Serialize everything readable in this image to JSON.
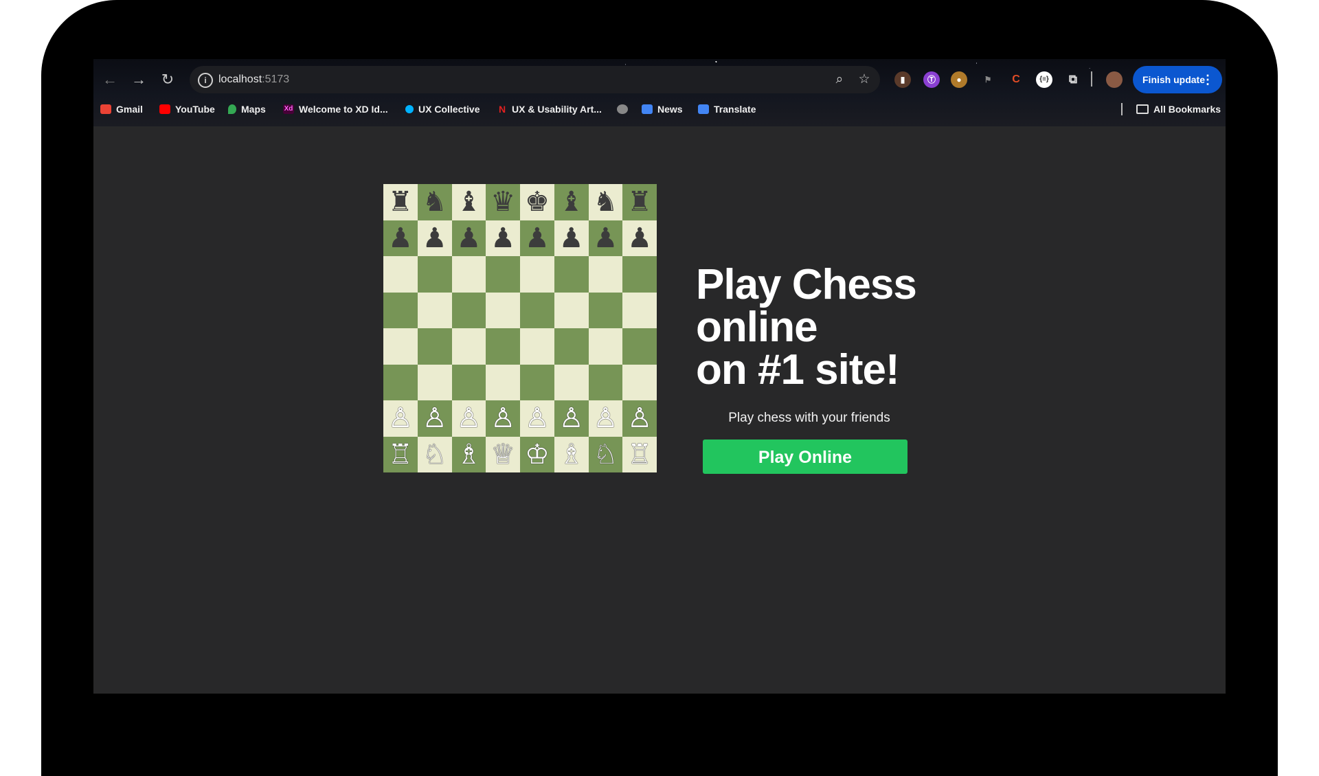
{
  "browser": {
    "url_host": "localhost",
    "url_port": ":5173",
    "icons": {
      "back": "back-arrow-icon",
      "forward": "forward-arrow-icon",
      "reload": "reload-icon",
      "site_info": "info-icon",
      "zoom": "zoom-icon",
      "bookmark_star": "star-icon",
      "extensions": "puzzle-icon"
    },
    "finish_update_label": "Finish update",
    "bookmarks": [
      {
        "label": "Gmail",
        "icon": "gmail-icon",
        "color": "#ea4335"
      },
      {
        "label": "YouTube",
        "icon": "youtube-icon",
        "color": "#ff0000"
      },
      {
        "label": "Maps",
        "icon": "maps-pin-icon",
        "color": "#34a853"
      },
      {
        "label": "Welcome to XD Id...",
        "icon": "xd-icon",
        "color": "#470137"
      },
      {
        "label": "UX Collective",
        "icon": "ux-collective-icon",
        "color": "#00b2ff"
      },
      {
        "label": "UX & Usability Art...",
        "icon": "nn-icon",
        "color": "#e02020"
      },
      {
        "label": "",
        "icon": "globe-icon",
        "color": "#888888"
      },
      {
        "label": "News",
        "icon": "news-icon",
        "color": "#4285f4"
      },
      {
        "label": "Translate",
        "icon": "translate-icon",
        "color": "#4285f4"
      }
    ],
    "all_bookmarks_label": "All Bookmarks"
  },
  "page": {
    "headline_line1": "Play Chess",
    "headline_line2": "online",
    "headline_line3": "on #1 site!",
    "subtitle": "Play chess with your friends",
    "cta_label": "Play Online"
  },
  "board": {
    "light_color": "#ebecd0",
    "dark_color": "#779556",
    "rows": [
      [
        "♜",
        "♞",
        "♝",
        "♛",
        "♚",
        "♝",
        "♞",
        "♜"
      ],
      [
        "♟",
        "♟",
        "♟",
        "♟",
        "♟",
        "♟",
        "♟",
        "♟"
      ],
      [
        "",
        "",
        "",
        "",
        "",
        "",
        "",
        ""
      ],
      [
        "",
        "",
        "",
        "",
        "",
        "",
        "",
        ""
      ],
      [
        "",
        "",
        "",
        "",
        "",
        "",
        "",
        ""
      ],
      [
        "",
        "",
        "",
        "",
        "",
        "",
        "",
        ""
      ],
      [
        "♙",
        "♙",
        "♙",
        "♙",
        "♙",
        "♙",
        "♙",
        "♙"
      ],
      [
        "♖",
        "♘",
        "♗",
        "♕",
        "♔",
        "♗",
        "♘",
        "♖"
      ]
    ]
  }
}
